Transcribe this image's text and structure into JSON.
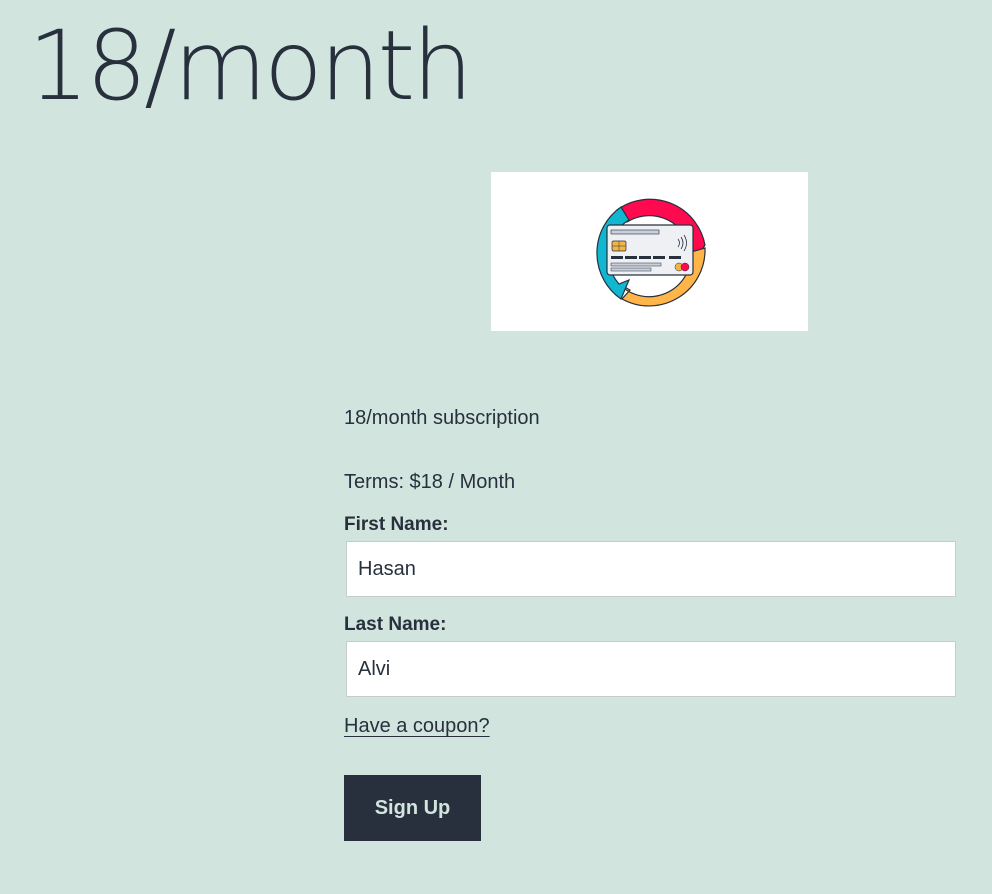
{
  "page": {
    "title": "18/month"
  },
  "product": {
    "image_icon": "credit-card-recurring-icon",
    "description": "18/month subscription",
    "terms": "Terms: $18 / Month"
  },
  "form": {
    "first_name_label": "First Name:",
    "first_name_value": "Hasan",
    "last_name_label": "Last Name:",
    "last_name_value": "Alvi",
    "coupon_link": "Have a coupon?",
    "signup_label": "Sign Up"
  },
  "colors": {
    "background": "#d1e4dd",
    "text": "#28303d",
    "button_bg": "#28303d",
    "button_text": "#d1e4dd",
    "arrow_red": "#ff0a4f",
    "arrow_cyan": "#11b7d0",
    "arrow_orange": "#ffb547"
  }
}
